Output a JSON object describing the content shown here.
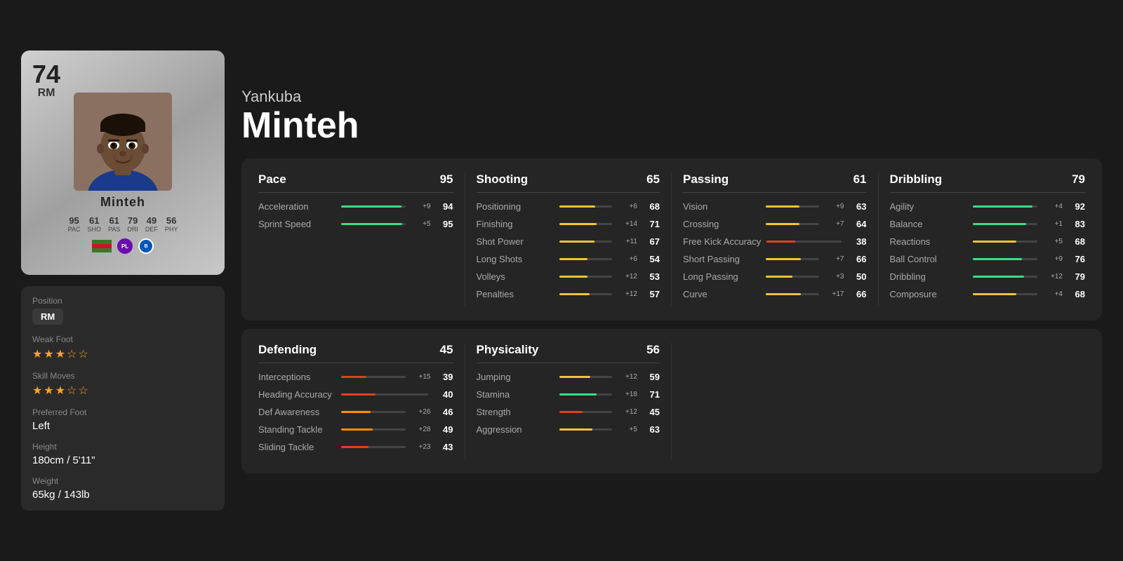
{
  "player": {
    "first_name": "Yankuba",
    "last_name": "Minteh",
    "rating": "74",
    "position": "RM",
    "card_stats": {
      "pac": {
        "label": "PAC",
        "value": "95"
      },
      "sho": {
        "label": "SHO",
        "value": "61"
      },
      "pas": {
        "label": "PAS",
        "value": "61"
      },
      "dri": {
        "label": "DRI",
        "value": "79"
      },
      "def": {
        "label": "DEF",
        "value": "49"
      },
      "phy": {
        "label": "PHY",
        "value": "56"
      }
    }
  },
  "info": {
    "position_label": "Position",
    "position_value": "RM",
    "weak_foot_label": "Weak Foot",
    "weak_foot_stars": 3,
    "weak_foot_max": 5,
    "skill_moves_label": "Skill Moves",
    "skill_moves_stars": 3,
    "skill_moves_max": 5,
    "preferred_foot_label": "Preferred Foot",
    "preferred_foot_value": "Left",
    "height_label": "Height",
    "height_value": "180cm / 5'11\"",
    "weight_label": "Weight",
    "weight_value": "65kg / 143lb"
  },
  "categories": {
    "pace": {
      "name": "Pace",
      "value": 95,
      "stats": [
        {
          "name": "Acceleration",
          "modifier": "+9",
          "value": 94,
          "bar_pct": 94,
          "bar_color": "green"
        },
        {
          "name": "Sprint Speed",
          "modifier": "+5",
          "value": 95,
          "bar_pct": 95,
          "bar_color": "green"
        }
      ]
    },
    "shooting": {
      "name": "Shooting",
      "value": 65,
      "stats": [
        {
          "name": "Positioning",
          "modifier": "+6",
          "value": 68,
          "bar_pct": 68,
          "bar_color": "yellow"
        },
        {
          "name": "Finishing",
          "modifier": "+14",
          "value": 71,
          "bar_pct": 71,
          "bar_color": "yellow"
        },
        {
          "name": "Shot Power",
          "modifier": "+11",
          "value": 67,
          "bar_pct": 67,
          "bar_color": "yellow"
        },
        {
          "name": "Long Shots",
          "modifier": "+6",
          "value": 54,
          "bar_pct": 54,
          "bar_color": "yellow"
        },
        {
          "name": "Volleys",
          "modifier": "+12",
          "value": 53,
          "bar_pct": 53,
          "bar_color": "yellow"
        },
        {
          "name": "Penalties",
          "modifier": "+12",
          "value": 57,
          "bar_pct": 57,
          "bar_color": "yellow"
        }
      ]
    },
    "passing": {
      "name": "Passing",
      "value": 61,
      "stats": [
        {
          "name": "Vision",
          "modifier": "+9",
          "value": 63,
          "bar_pct": 63,
          "bar_color": "yellow"
        },
        {
          "name": "Crossing",
          "modifier": "+7",
          "value": 64,
          "bar_pct": 64,
          "bar_color": "yellow"
        },
        {
          "name": "Free Kick Accuracy",
          "modifier": "",
          "value": 38,
          "bar_pct": 38,
          "bar_color": "red"
        },
        {
          "name": "Short Passing",
          "modifier": "+7",
          "value": 66,
          "bar_pct": 66,
          "bar_color": "yellow"
        },
        {
          "name": "Long Passing",
          "modifier": "+3",
          "value": 50,
          "bar_pct": 50,
          "bar_color": "yellow"
        },
        {
          "name": "Curve",
          "modifier": "+17",
          "value": 66,
          "bar_pct": 66,
          "bar_color": "yellow"
        }
      ]
    },
    "dribbling": {
      "name": "Dribbling",
      "value": 79,
      "stats": [
        {
          "name": "Agility",
          "modifier": "+4",
          "value": 92,
          "bar_pct": 92,
          "bar_color": "green"
        },
        {
          "name": "Balance",
          "modifier": "+1",
          "value": 83,
          "bar_pct": 83,
          "bar_color": "green"
        },
        {
          "name": "Reactions",
          "modifier": "+5",
          "value": 68,
          "bar_pct": 68,
          "bar_color": "yellow"
        },
        {
          "name": "Ball Control",
          "modifier": "+9",
          "value": 76,
          "bar_pct": 76,
          "bar_color": "green"
        },
        {
          "name": "Dribbling",
          "modifier": "+12",
          "value": 79,
          "bar_pct": 79,
          "bar_color": "green"
        },
        {
          "name": "Composure",
          "modifier": "+4",
          "value": 68,
          "bar_pct": 68,
          "bar_color": "yellow"
        }
      ]
    },
    "defending": {
      "name": "Defending",
      "value": 45,
      "stats": [
        {
          "name": "Interceptions",
          "modifier": "+15",
          "value": 39,
          "bar_pct": 39,
          "bar_color": "red"
        },
        {
          "name": "Heading Accuracy",
          "modifier": "",
          "value": 40,
          "bar_pct": 40,
          "bar_color": "red"
        },
        {
          "name": "Def Awareness",
          "modifier": "+26",
          "value": 46,
          "bar_pct": 46,
          "bar_color": "orange"
        },
        {
          "name": "Standing Tackle",
          "modifier": "+28",
          "value": 49,
          "bar_pct": 49,
          "bar_color": "orange"
        },
        {
          "name": "Sliding Tackle",
          "modifier": "+23",
          "value": 43,
          "bar_pct": 43,
          "bar_color": "red"
        }
      ]
    },
    "physicality": {
      "name": "Physicality",
      "value": 56,
      "stats": [
        {
          "name": "Jumping",
          "modifier": "+12",
          "value": 59,
          "bar_pct": 59,
          "bar_color": "yellow"
        },
        {
          "name": "Stamina",
          "modifier": "+18",
          "value": 71,
          "bar_pct": 71,
          "bar_color": "green"
        },
        {
          "name": "Strength",
          "modifier": "+12",
          "value": 45,
          "bar_pct": 45,
          "bar_color": "red"
        },
        {
          "name": "Aggression",
          "modifier": "+5",
          "value": 63,
          "bar_pct": 63,
          "bar_color": "yellow"
        }
      ]
    }
  }
}
